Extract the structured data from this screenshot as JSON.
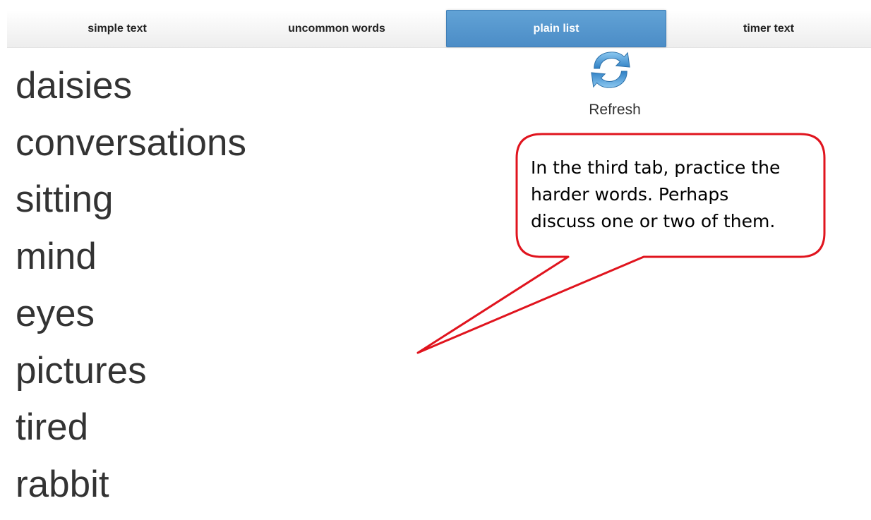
{
  "tabs": [
    {
      "label": "simple text",
      "active": false
    },
    {
      "label": "uncommon words",
      "active": false
    },
    {
      "label": "plain list",
      "active": true
    },
    {
      "label": "timer text",
      "active": false
    }
  ],
  "refresh": {
    "icon": "refresh-icon",
    "label": "Refresh"
  },
  "words": [
    "daisies",
    "conversations",
    "sitting",
    "mind",
    "eyes",
    "pictures",
    "tired",
    "rabbit"
  ],
  "callout": {
    "text": "In the third tab, practice the\nharder words.  Perhaps\ndiscuss one or two of them.",
    "border_color": "#e0141e"
  },
  "colors": {
    "active_tab": "#5596cf",
    "text": "#333333"
  }
}
